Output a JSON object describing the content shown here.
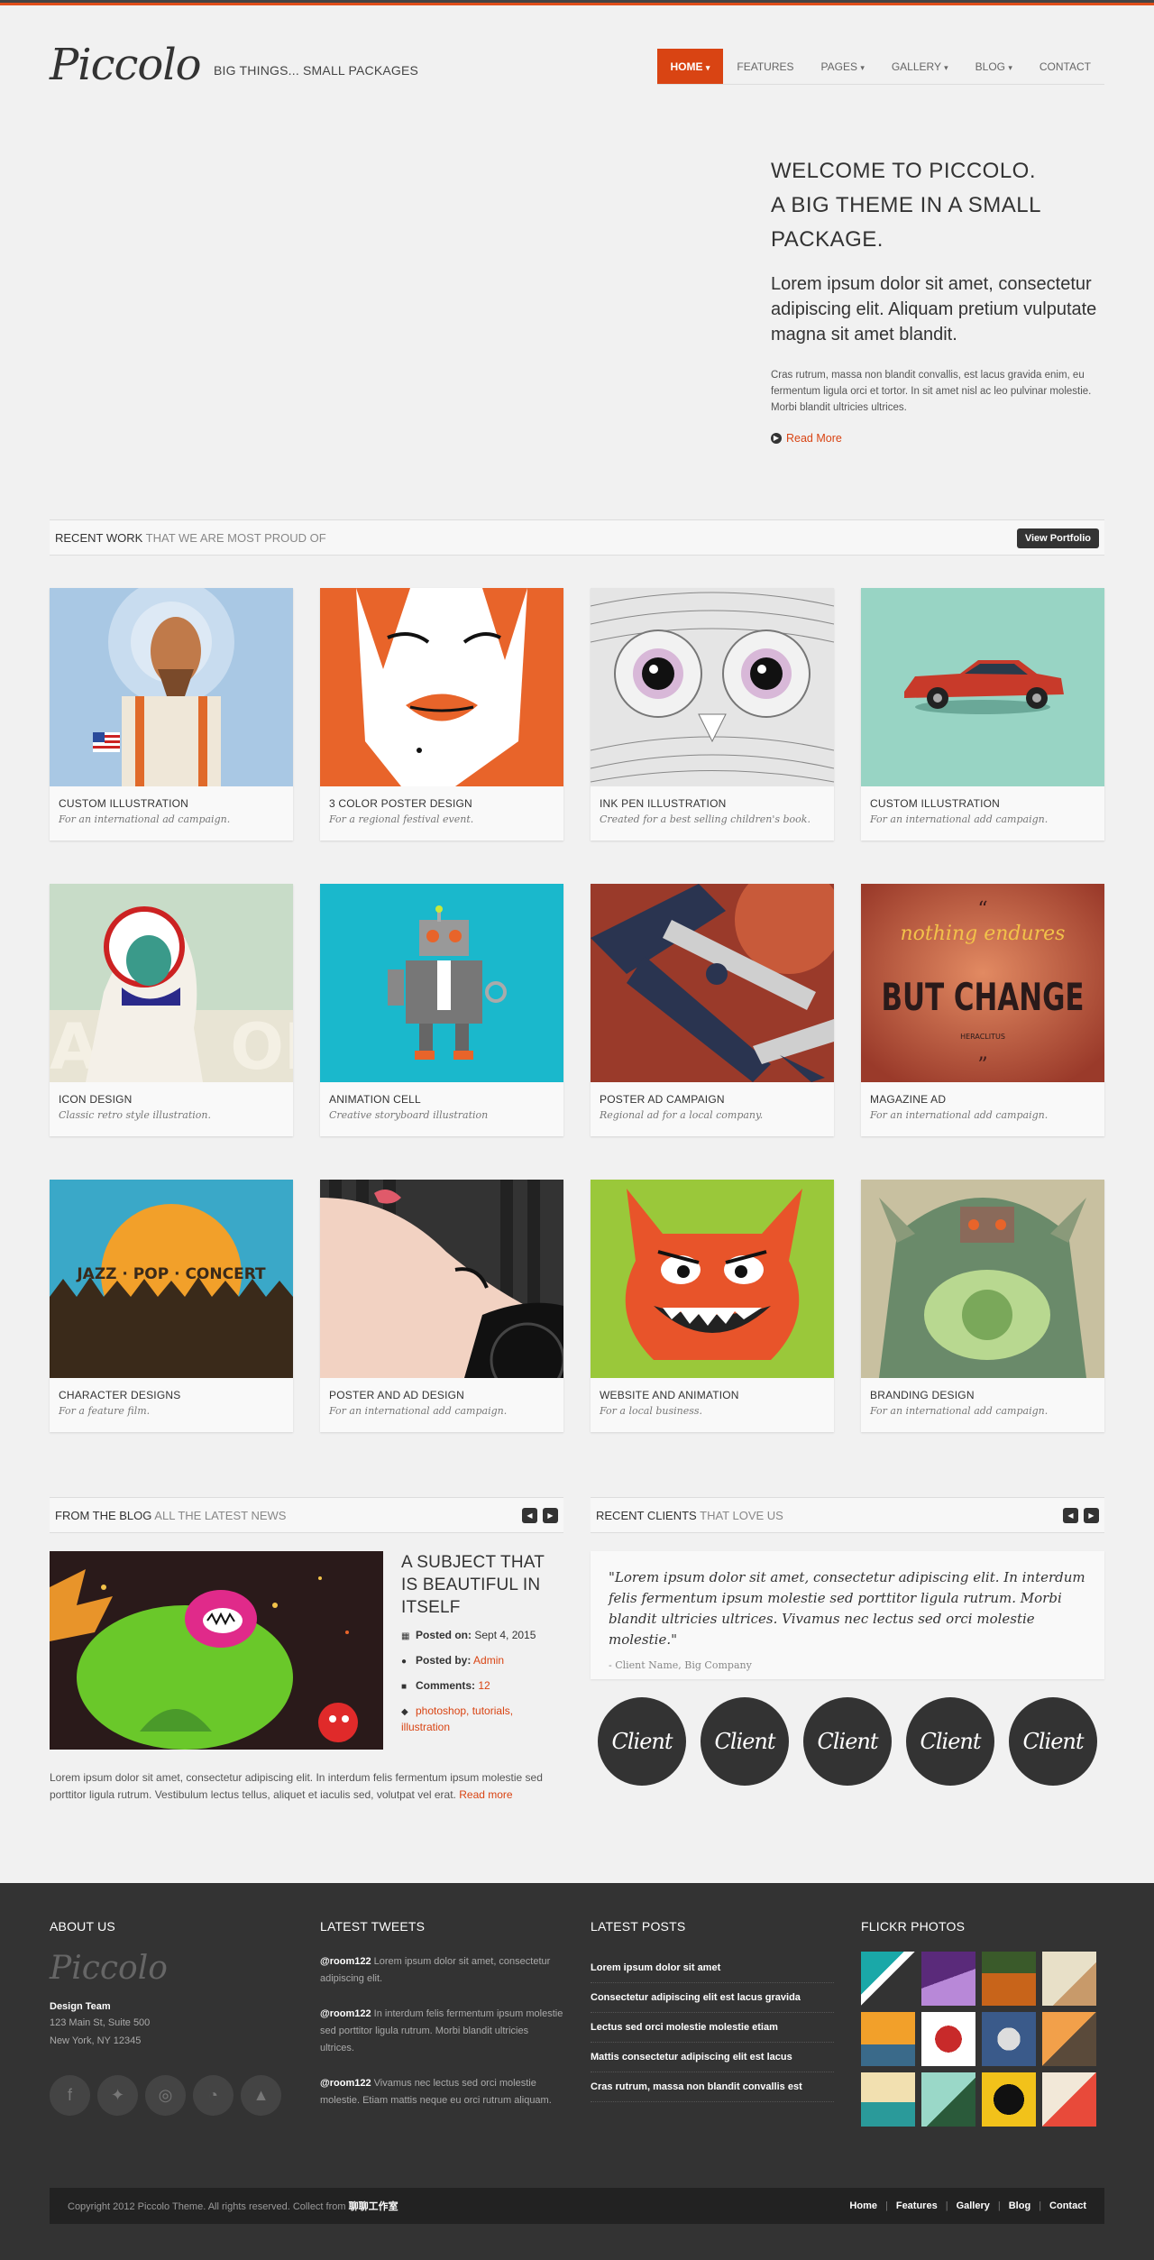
{
  "header": {
    "logo": "Piccolo",
    "tagline": "BIG THINGS... SMALL PACKAGES",
    "nav": [
      {
        "label": "HOME",
        "caret": "▾",
        "active": true
      },
      {
        "label": "FEATURES",
        "caret": ""
      },
      {
        "label": "PAGES",
        "caret": "▾"
      },
      {
        "label": "GALLERY",
        "caret": "▾"
      },
      {
        "label": "BLOG",
        "caret": "▾"
      },
      {
        "label": "CONTACT",
        "caret": ""
      }
    ]
  },
  "hero": {
    "title_line1": "WELCOME TO PICCOLO.",
    "title_line2": "A BIG THEME IN A SMALL PACKAGE.",
    "lead": "Lorem ipsum dolor sit amet, consectetur adipiscing elit. Aliquam pretium vulputate magna sit amet blandit.",
    "body": "Cras rutrum, massa non blandit convallis, est lacus gravida enim, eu fermentum ligula orci et tortor. In sit amet nisl ac leo pulvinar molestie. Morbi blandit ultricies ultrices.",
    "read_more": "Read More"
  },
  "recent_work": {
    "title_strong": "RECENT WORK",
    "title_sub": "THAT WE ARE MOST PROUD OF",
    "button": "View Portfolio",
    "items": [
      {
        "title": "CUSTOM ILLUSTRATION",
        "desc": "For an international ad campaign."
      },
      {
        "title": "3 COLOR POSTER DESIGN",
        "desc": "For a regional festival event."
      },
      {
        "title": "INK PEN ILLUSTRATION",
        "desc": "Created for a best selling children's book."
      },
      {
        "title": "CUSTOM ILLUSTRATION",
        "desc": "For an international add campaign."
      },
      {
        "title": "ICON DESIGN",
        "desc": "Classic retro style illustration."
      },
      {
        "title": "ANIMATION CELL",
        "desc": "Creative storyboard illustration"
      },
      {
        "title": "POSTER AD CAMPAIGN",
        "desc": "Regional ad for a local company."
      },
      {
        "title": "MAGAZINE AD",
        "desc": "For an international add campaign."
      },
      {
        "title": "CHARACTER DESIGNS",
        "desc": "For a feature film."
      },
      {
        "title": "POSTER AND AD DESIGN",
        "desc": "For an international add campaign."
      },
      {
        "title": "WEBSITE AND ANIMATION",
        "desc": "For a local business."
      },
      {
        "title": "BRANDING DESIGN",
        "desc": "For an international add campaign."
      }
    ],
    "art_text": {
      "quote_top": "nothing endures",
      "quote_main1": "BUT CHANGE",
      "quote_author": "HERACLITUS",
      "jazz": "JAZZ · POP · CONCERT"
    }
  },
  "blog": {
    "title_strong": "FROM THE BLOG",
    "title_sub": "ALL THE LATEST NEWS",
    "post_title": "A SUBJECT THAT IS BEAUTIFUL IN ITSELF",
    "posted_on_label": "Posted on:",
    "posted_on": "Sept 4, 2015",
    "posted_by_label": "Posted by:",
    "posted_by": "Admin",
    "comments_label": "Comments:",
    "comments": "12",
    "tags": "photoshop, tutorials, illustration",
    "excerpt": "Lorem ipsum dolor sit amet, consectetur adipiscing elit. In interdum felis fermentum ipsum molestie sed porttitor ligula rutrum. Vestibulum lectus tellus, aliquet et iaculis sed, volutpat vel erat.",
    "read_more": "Read more"
  },
  "clients": {
    "title_strong": "RECENT CLIENTS",
    "title_sub": "THAT LOVE US",
    "quote": "\"Lorem ipsum dolor sit amet, consectetur adipiscing elit. In interdum felis fermentum ipsum molestie sed porttitor ligula rutrum. Morbi blandit ultricies ultrices. Vivamus nec lectus sed orci molestie molestie.\"",
    "author": "- Client Name, Big Company",
    "logos": [
      "Client",
      "Client",
      "Client",
      "Client",
      "Client"
    ]
  },
  "footer": {
    "about_title": "ABOUT US",
    "logo": "Piccolo",
    "team": "Design Team",
    "addr1": "123 Main St, Suite 500",
    "addr2": "New York, NY 12345",
    "tweets_title": "LATEST TWEETS",
    "tweets": [
      {
        "user": "@room122",
        "text": "Lorem ipsum dolor sit amet, consectetur adipiscing elit."
      },
      {
        "user": "@room122",
        "text": "In interdum felis fermentum ipsum molestie sed porttitor ligula rutrum. Morbi blandit ultricies ultrices."
      },
      {
        "user": "@room122",
        "text": "Vivamus nec lectus sed orci molestie molestie. Etiam mattis neque eu orci rutrum aliquam."
      }
    ],
    "posts_title": "LATEST POSTS",
    "posts": [
      "Lorem ipsum dolor sit amet",
      "Consectetur adipiscing elit est lacus gravida",
      "Lectus sed orci molestie molestie etiam",
      "Mattis consectetur adipiscing elit est lacus",
      "Cras rutrum, massa non blandit convallis est"
    ],
    "flickr_title": "FLICKR PHOTOS",
    "copyright": "Copyright 2012 Piccolo Theme. All rights reserved. Collect from",
    "copyright_link": "聊聊工作室",
    "links": [
      "Home",
      "Features",
      "Gallery",
      "Blog",
      "Contact"
    ]
  },
  "colors": {
    "accent": "#d94413",
    "dark": "#333333",
    "footer": "#333333"
  }
}
